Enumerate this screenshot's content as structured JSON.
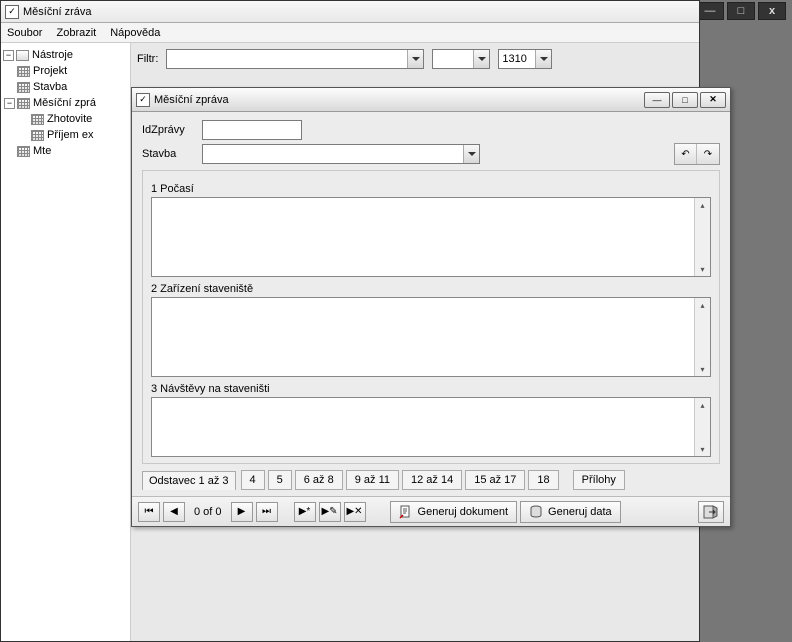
{
  "outer": {
    "title": "Měsíční zráva"
  },
  "menu": {
    "file": "Soubor",
    "view": "Zobrazit",
    "help": "Nápověda"
  },
  "tree": {
    "root": "Nástroje",
    "projekt": "Projekt",
    "stavba": "Stavba",
    "mesicni": "Měsíční zprá",
    "zhotovite": "Zhotovite",
    "prijem": "Příjem ex",
    "mte": "Mte"
  },
  "filter": {
    "label": "Filtr:",
    "combo1": "",
    "combo2": "",
    "combo3": "1310"
  },
  "inner": {
    "title": "Měsíční zpráva",
    "idLabel": "IdZprávy",
    "idValue": "",
    "stavbaLabel": "Stavba",
    "stavbaValue": "",
    "sect1": "1 Počasí",
    "sect2": "2 Zařízení staveniště",
    "sect3": "3 Návštěvy na staveništi",
    "tabsLead": "Odstavec 1 až 3",
    "tabs": [
      "4",
      "5",
      "6 až 8",
      "9 až 11",
      "12 až 14",
      "15 až 17",
      "18"
    ],
    "tabAttach": "Přílohy"
  },
  "nav": {
    "counter": "0 of  0",
    "genDoc": "Generuj dokument",
    "genData": "Generuj data"
  },
  "frame": {
    "min": "—",
    "max": "□",
    "close": "x"
  }
}
